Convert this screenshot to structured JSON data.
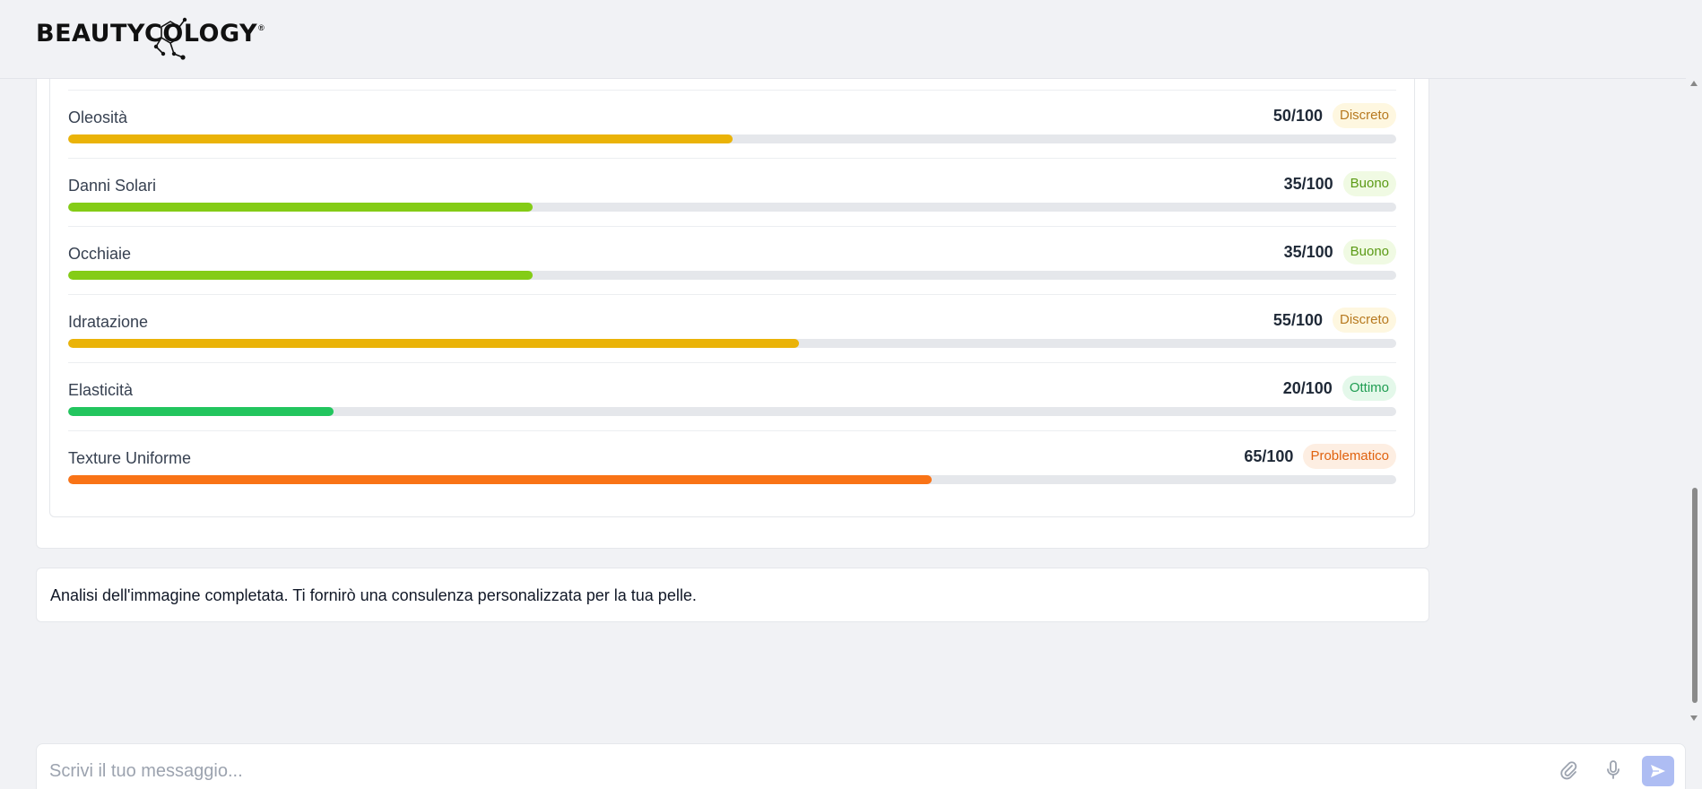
{
  "brand": {
    "logo_text": "BEAUTYCOLOGY",
    "registered_mark": "®"
  },
  "metrics": [
    {
      "label": "Oleosità",
      "score": "50/100",
      "value": 50,
      "status": "Discreto",
      "bar_color": "#eab308",
      "badge_bg": "#fef7e0",
      "badge_color": "#b7791f"
    },
    {
      "label": "Danni Solari",
      "score": "35/100",
      "value": 35,
      "status": "Buono",
      "bar_color": "#84cc16",
      "badge_bg": "#f0fae3",
      "badge_color": "#5b9a15"
    },
    {
      "label": "Occhiaie",
      "score": "35/100",
      "value": 35,
      "status": "Buono",
      "bar_color": "#84cc16",
      "badge_bg": "#f0fae3",
      "badge_color": "#5b9a15"
    },
    {
      "label": "Idratazione",
      "score": "55/100",
      "value": 55,
      "status": "Discreto",
      "bar_color": "#eab308",
      "badge_bg": "#fef7e0",
      "badge_color": "#b7791f"
    },
    {
      "label": "Elasticità",
      "score": "20/100",
      "value": 20,
      "status": "Ottimo",
      "bar_color": "#22c55e",
      "badge_bg": "#e4f8ea",
      "badge_color": "#1f9d52"
    },
    {
      "label": "Texture Uniforme",
      "score": "65/100",
      "value": 65,
      "status": "Problematico",
      "bar_color": "#f97316",
      "badge_bg": "#fdeee2",
      "badge_color": "#e0620f"
    }
  ],
  "message": {
    "text": "Analisi dell'immagine completata. Ti fornirò una consulenza personalizzata per la tua pelle."
  },
  "input": {
    "placeholder": "Scrivi il tuo messaggio...",
    "value": ""
  },
  "icons": {
    "attach": "paperclip-icon",
    "mic": "microphone-icon",
    "send": "send-icon"
  },
  "colors": {
    "send_button": "#aebdf3",
    "track": "#e5e7eb",
    "background": "#f1f2f5"
  }
}
